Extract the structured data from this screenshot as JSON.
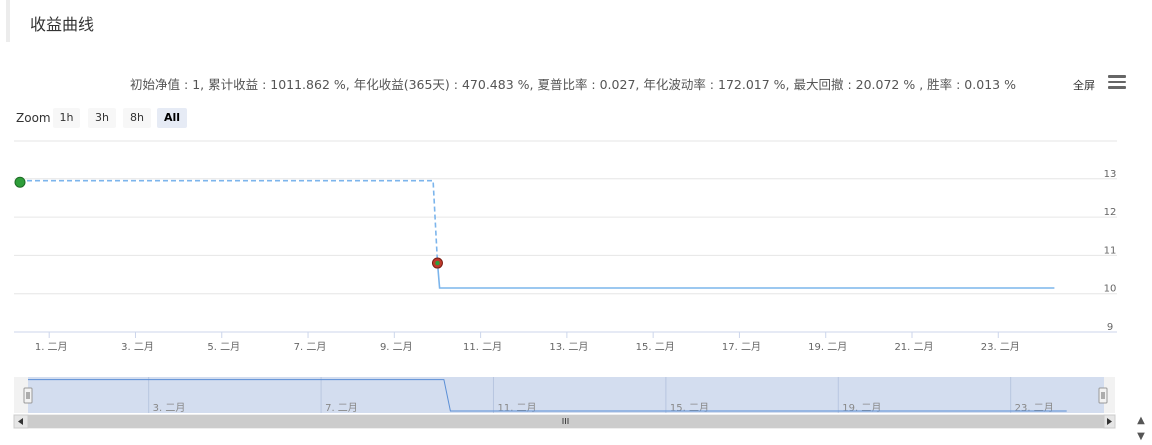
{
  "page": {
    "title": "收益曲线"
  },
  "stats_text": "初始净值 : 1, 累计收益 : 1011.862 %, 年化收益(365天) : 470.483 %, 夏普比率 : 0.027, 年化波动率 : 172.017 %, 最大回撤 : 20.072 % , 胜率 : 0.013 %",
  "toolbar": {
    "fullscreen_label": "全屏",
    "menu_icon": "hamburger-menu-icon"
  },
  "zoom": {
    "label": "Zoom",
    "buttons": [
      "1h",
      "3h",
      "8h",
      "All"
    ],
    "selected": "All"
  },
  "navigator": {
    "tick_labels": [
      "3. 二月",
      "7. 二月",
      "11. 二月",
      "15. 二月",
      "19. 二月",
      "23. 二月"
    ],
    "scrollbar_handle_icon": "grip-icon",
    "left_arrow_icon": "arrow-left-icon",
    "right_arrow_icon": "arrow-right-icon"
  },
  "range_nav": {
    "up_icon": "chevron-up-icon",
    "down_icon": "chevron-down-icon"
  },
  "colors": {
    "line": "#7cb5ec",
    "marker_green": "#2e9e3a",
    "marker_red": "#c0392b",
    "navigator_fill": "#cfdaee",
    "navigator_line": "#5b8fd6"
  },
  "chart_data": {
    "type": "line",
    "x_unit": "day of 二月",
    "xlim": [
      0.2,
      24.3
    ],
    "ylim": [
      9,
      14
    ],
    "y_ticks": [
      9,
      10,
      11,
      12,
      13
    ],
    "x_ticks": [
      {
        "x": 1,
        "label": "1. 二月"
      },
      {
        "x": 3,
        "label": "3. 二月"
      },
      {
        "x": 5,
        "label": "5. 二月"
      },
      {
        "x": 7,
        "label": "7. 二月"
      },
      {
        "x": 9,
        "label": "9. 二月"
      },
      {
        "x": 11,
        "label": "11. 二月"
      },
      {
        "x": 13,
        "label": "13. 二月"
      },
      {
        "x": 15,
        "label": "15. 二月"
      },
      {
        "x": 17,
        "label": "17. 二月"
      },
      {
        "x": 19,
        "label": "19. 二月"
      },
      {
        "x": 21,
        "label": "21. 二月"
      },
      {
        "x": 23,
        "label": "23. 二月"
      }
    ],
    "series": [
      {
        "style": "dashed",
        "points": [
          [
            0.3,
            12.95
          ],
          [
            9.9,
            12.95
          ],
          [
            10.0,
            10.8
          ]
        ]
      },
      {
        "style": "solid",
        "points": [
          [
            10.0,
            10.8
          ],
          [
            10.05,
            10.15
          ],
          [
            24.3,
            10.15
          ]
        ]
      }
    ],
    "markers": [
      {
        "x": 0.3,
        "y": 12.95,
        "color": "green"
      },
      {
        "x": 10.0,
        "y": 10.8,
        "color": "red"
      }
    ],
    "grid": true,
    "legend": "none"
  }
}
